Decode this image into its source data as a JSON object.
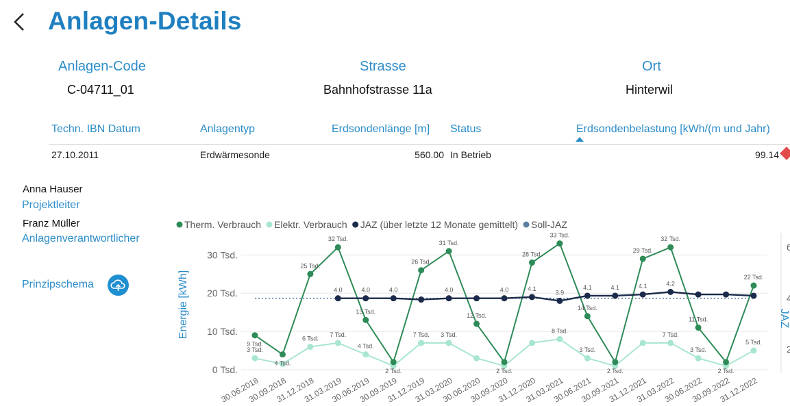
{
  "page": {
    "title": "Anlagen-Details"
  },
  "info": {
    "code_label": "Anlagen-Code",
    "code_value": "C-04711_01",
    "street_label": "Strasse",
    "street_value": "Bahnhofstrasse 11a",
    "city_label": "Ort",
    "city_value": "Hinterwil"
  },
  "table": {
    "headers": [
      "Techn. IBN Datum",
      "Anlagentyp",
      "Erdsondenlänge [m]",
      "Status",
      "Erdsondenbelastung [kWh/(m und Jahr)"
    ],
    "row": [
      "27.10.2011",
      "Erdwärmesonde",
      "560.00",
      "In Betrieb",
      "99.14"
    ]
  },
  "people": [
    {
      "name": "Anna Hauser",
      "role": "Projektleiter"
    },
    {
      "name": "Franz Müller",
      "role": "Anlagenverantwortlicher"
    }
  ],
  "schema": {
    "label": "Prinzipschema",
    "icon": "cloud-icon"
  },
  "colors": {
    "accent": "#2b8cc9",
    "therm": "#2e8b57",
    "elektr": "#a8e6cf",
    "jaz": "#1b2a4a",
    "soll": "#5b7fa3"
  },
  "chart_data": {
    "type": "line",
    "legend": [
      "Therm. Verbrauch",
      "Elektr. Verbrauch",
      "JAZ (über letzte 12 Monate gemittelt)",
      "Soll-JAZ"
    ],
    "x": [
      "30.06.2018",
      "30.09.2018",
      "31.12.2018",
      "31.03.2019",
      "30.06.2019",
      "30.09.2019",
      "31.12.2019",
      "31.03.2020",
      "30.06.2020",
      "30.09.2020",
      "31.12.2020",
      "31.03.2021",
      "30.06.2021",
      "30.09.2021",
      "31.12.2021",
      "31.03.2022",
      "30.06.2022",
      "30.09.2022",
      "31.12.2022"
    ],
    "ylabel": "Energie [kWh]",
    "y2label": "JAZ",
    "y_ticks": [
      "0 Tsd.",
      "10 Tsd.",
      "20 Tsd.",
      "30 Tsd."
    ],
    "y2_ticks": [
      "2",
      "4",
      "6"
    ],
    "ylim": [
      0,
      34000
    ],
    "y2lim": [
      1.2,
      6.3
    ],
    "series": [
      {
        "name": "Therm. Verbrauch",
        "values": [
          9000,
          4000,
          25000,
          32000,
          13000,
          2000,
          26000,
          31000,
          12000,
          2000,
          28000,
          33000,
          14000,
          2000,
          29000,
          32000,
          11000,
          2000,
          22000
        ],
        "labels": [
          "9 Tsd.",
          "4 Tsd.",
          "25 Tsd.",
          "32 Tsd.",
          "13 Tsd.",
          "2 Tsd.",
          "26 Tsd.",
          "31 Tsd.",
          "12 Tsd.",
          "2 Tsd.",
          "28 Tsd.",
          "33 Tsd.",
          "14 Tsd.",
          "2 Tsd.",
          "29 Tsd.",
          "32 Tsd.",
          "11 Tsd.",
          "2 Tsd.",
          "22 Tsd."
        ]
      },
      {
        "name": "Elektr. Verbrauch",
        "values": [
          3000,
          1500,
          6000,
          7000,
          4000,
          1000,
          7000,
          7000,
          3000,
          1000,
          7000,
          8000,
          3000,
          1000,
          7000,
          7000,
          3000,
          1000,
          5000
        ],
        "labels": [
          "3 Tsd.",
          "",
          "6 Tsd.",
          "7 Tsd.",
          "4 Tsd.",
          "",
          "7 Tsd.",
          "3 Tsd.",
          "",
          "",
          "",
          "8 Tsd.",
          "3 Tsd.",
          "",
          "",
          "7 Tsd.",
          "3 Tsd.",
          "",
          "5 Tsd."
        ]
      },
      {
        "name": "JAZ (über letzte 12 Monate gemittelt)",
        "values": [
          null,
          null,
          null,
          4.0,
          4.0,
          4.0,
          3.95,
          4.0,
          4.0,
          4.0,
          4.05,
          3.9,
          4.1,
          4.1,
          4.15,
          4.25,
          4.15,
          4.15,
          4.1
        ],
        "labels": [
          "",
          "",
          "",
          "4.0",
          "4.0",
          "4.0",
          "",
          "4.0",
          "",
          "4.0",
          "4.1",
          "3.9",
          "4.1",
          "4.1",
          "4.1",
          "4.2",
          "",
          "",
          ""
        ]
      },
      {
        "name": "Soll-JAZ",
        "values": [
          4,
          4,
          4,
          4,
          4,
          4,
          4,
          4,
          4,
          4,
          4,
          4,
          4,
          4,
          4,
          4,
          4,
          4,
          4
        ]
      }
    ]
  }
}
